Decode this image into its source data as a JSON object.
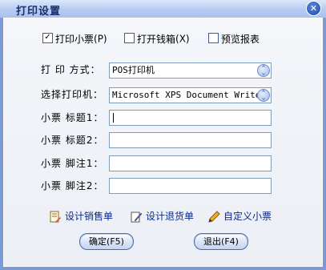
{
  "window": {
    "title": "打印设置",
    "close_glyph": "✕"
  },
  "options": [
    {
      "label": "打印小票",
      "key": "(P)",
      "checked": true
    },
    {
      "label": "打开钱箱",
      "key": "(X)",
      "checked": false
    },
    {
      "label": "预览报表",
      "key": "",
      "checked": false
    }
  ],
  "fields": {
    "print_mode": {
      "label": "打 印 方式：",
      "value": "POS打印机"
    },
    "printer": {
      "label": "选择打印机：",
      "value": "Microsoft XPS Document Writer"
    },
    "title1": {
      "label": "小票 标题1：",
      "value": ""
    },
    "title2": {
      "label": "小票 标题2：",
      "value": ""
    },
    "footer1": {
      "label": "小票 脚注1：",
      "value": ""
    },
    "footer2": {
      "label": "小票 脚注2：",
      "value": ""
    }
  },
  "links": {
    "design_sales": {
      "label": "设计销售单",
      "icon": "edit-document-icon"
    },
    "design_return": {
      "label": "设计退货单",
      "icon": "pen-document-icon"
    },
    "custom_receipt": {
      "label": "自定义小票",
      "icon": "pencil-icon"
    }
  },
  "buttons": {
    "ok": "确定(F5)",
    "exit": "退出(F4)"
  }
}
